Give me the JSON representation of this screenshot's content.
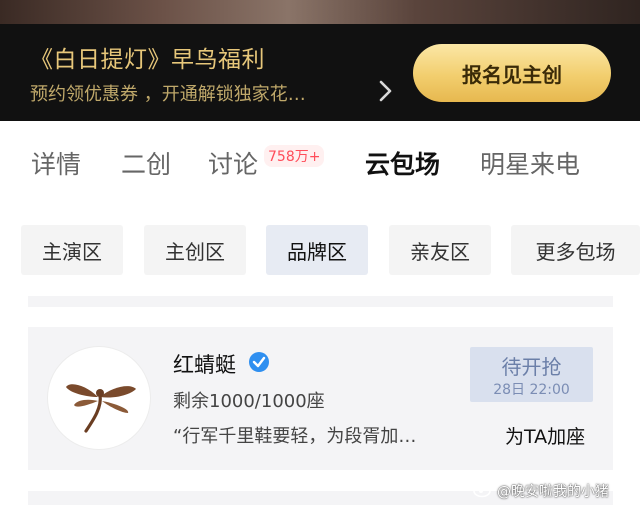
{
  "promo": {
    "title": "《白日提灯》早鸟福利",
    "subtitle": "预约领优惠券 ，开通解锁独家花…",
    "button_label": "报名见主创",
    "colors": {
      "gold": "#e7c77a",
      "button": "#f2ce6e"
    }
  },
  "tabs": [
    {
      "label": "详情"
    },
    {
      "label": "二创"
    },
    {
      "label": "讨论"
    },
    {
      "label": "云包场"
    },
    {
      "label": "明星来电"
    }
  ],
  "discussion_badge": "758万+",
  "active_tab": "云包场",
  "chips": [
    {
      "label": "主演区"
    },
    {
      "label": "主创区"
    },
    {
      "label": "品牌区"
    },
    {
      "label": "亲友区"
    },
    {
      "label": "更多包场"
    }
  ],
  "active_chip": "品牌区",
  "card": {
    "brand_name": "红蜻蜓",
    "verified_icon": "verified-badge-icon",
    "seats": "剩余1000/1000座",
    "quote": "“行军千里鞋要轻，为段胥加…",
    "status": "待开抢",
    "status_time": "28日 22:00",
    "action": "为TA加座",
    "avatar_icon": "dragonfly-logo-icon"
  },
  "watermark": "@晚安啦我的小猪"
}
